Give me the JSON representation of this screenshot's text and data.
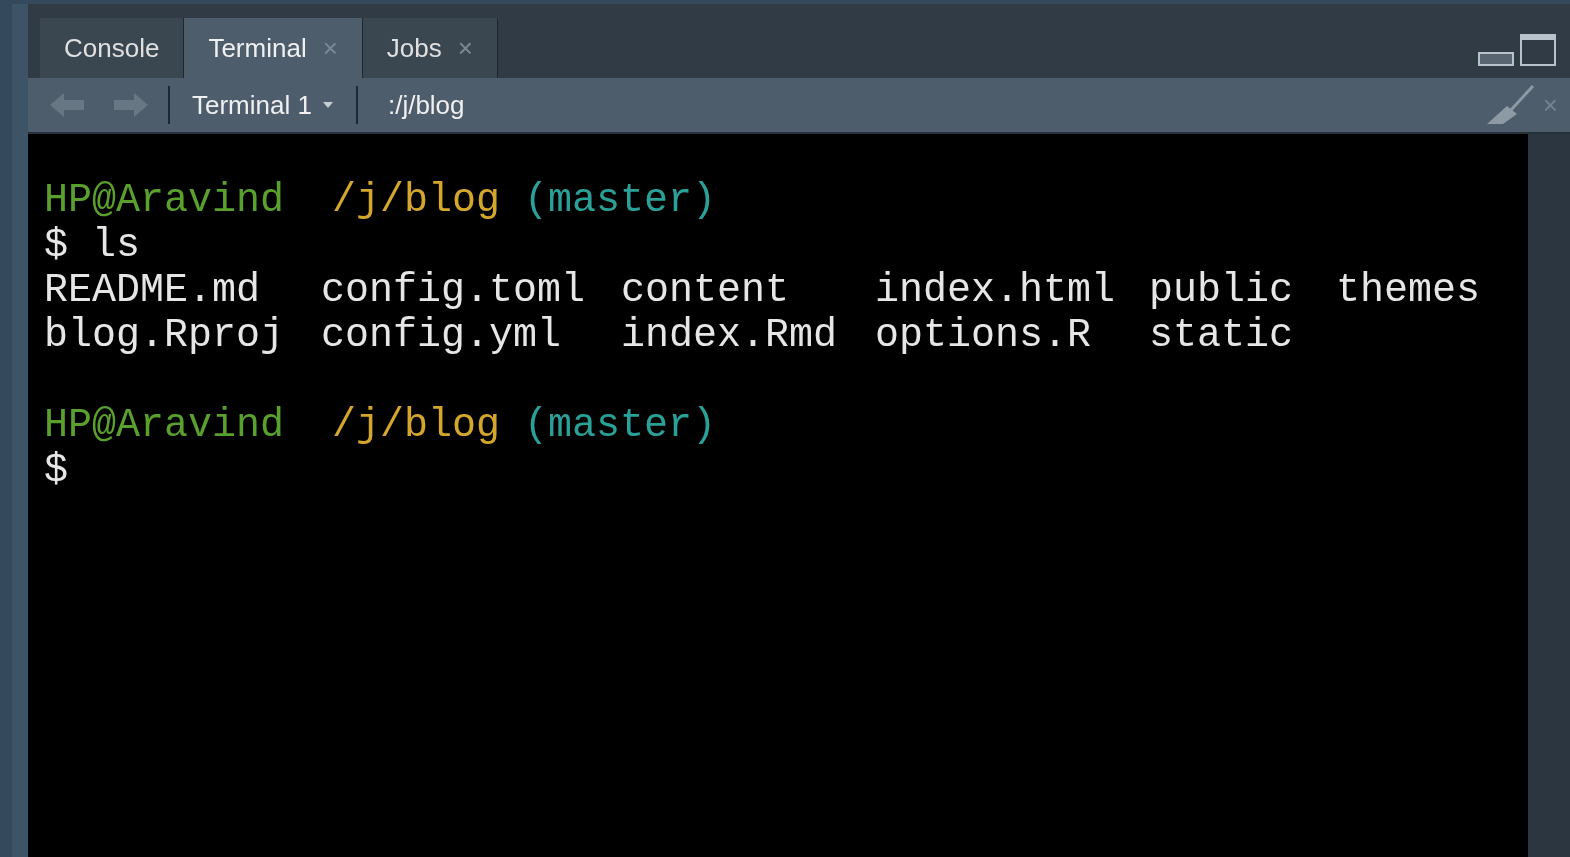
{
  "tabs": [
    {
      "label": "Console",
      "selected": false
    },
    {
      "label": "Terminal",
      "selected": true,
      "close": "×"
    },
    {
      "label": "Jobs",
      "selected": false,
      "close": "×"
    }
  ],
  "toolbar": {
    "terminal_menu": "Terminal 1",
    "path": ":/j/blog",
    "close": "×"
  },
  "terminal": {
    "blocks": [
      {
        "kind": "prompt",
        "segments": [
          {
            "kind": "user",
            "text": "HP@Aravind"
          },
          {
            "kind": "path",
            "text": "/j/blog"
          },
          {
            "kind": "branch",
            "text": "(master)"
          }
        ],
        "command": "$ ls"
      },
      {
        "kind": "listing",
        "rows": [
          [
            "README.md",
            "config.toml",
            "content",
            "index.html",
            "public",
            "themes"
          ],
          [
            "blog.Rproj",
            "config.yml",
            "index.Rmd",
            "options.R",
            "static"
          ]
        ]
      },
      {
        "kind": "prompt",
        "segments": [
          {
            "kind": "user",
            "text": "HP@Aravind"
          },
          {
            "kind": "path",
            "text": "/j/blog"
          },
          {
            "kind": "branch",
            "text": "(master)"
          }
        ],
        "command": "$"
      }
    ]
  }
}
